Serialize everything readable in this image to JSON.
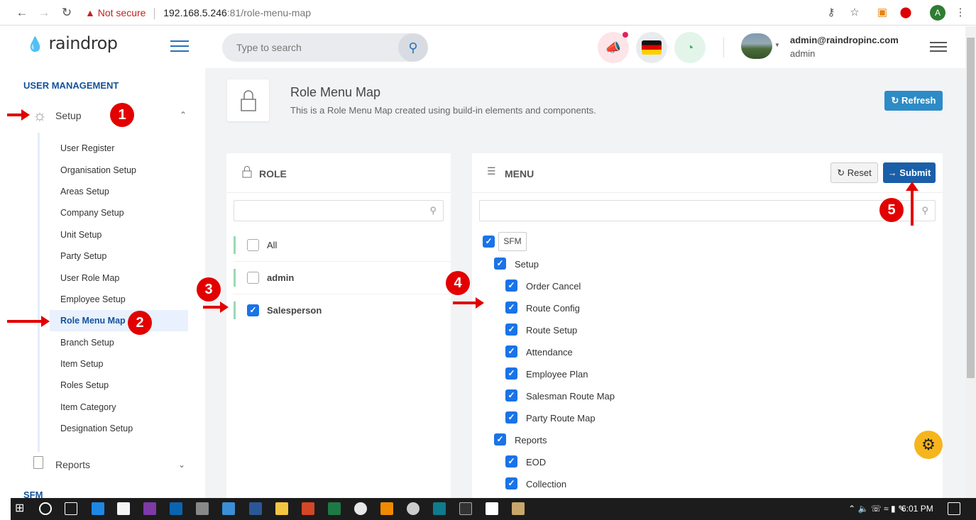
{
  "browser": {
    "not_secure": "Not secure",
    "url_host": "192.168.5.246",
    "url_path": ":81/role-menu-map"
  },
  "sidebar": {
    "logo": "raindrop",
    "section_user_mgmt": "USER MANAGEMENT",
    "setup_label": "Setup",
    "items": [
      "User Register",
      "Organisation Setup",
      "Areas Setup",
      "Company Setup",
      "Unit Setup",
      "Party Setup",
      "User Role Map",
      "Employee Setup",
      "Role Menu Map",
      "Branch Setup",
      "Item Setup",
      "Roles Setup",
      "Item Category",
      "Designation Setup"
    ],
    "active_item": "Role Menu Map",
    "reports_label": "Reports",
    "section_sfm": "SFM"
  },
  "header": {
    "search_placeholder": "Type to search",
    "user_email": "admin@raindropinc.com",
    "user_role": "admin"
  },
  "page": {
    "title": "Role Menu Map",
    "subtitle": "This is a Role Menu Map created using build-in elements and components.",
    "refresh_label": "Refresh"
  },
  "role_panel": {
    "title": "ROLE",
    "roles": [
      {
        "label": "All",
        "checked": false
      },
      {
        "label": "admin",
        "checked": false
      },
      {
        "label": "Salesperson",
        "checked": true
      }
    ]
  },
  "menu_panel": {
    "title": "MENU",
    "reset_label": "Reset",
    "submit_label": "Submit",
    "root": "SFM",
    "groups": [
      {
        "label": "Setup",
        "items": [
          "Order Cancel",
          "Route Config",
          "Route Setup",
          "Attendance",
          "Employee Plan",
          "Salesman Route Map",
          "Party Route Map"
        ]
      },
      {
        "label": "Reports",
        "items": [
          "EOD",
          "Collection"
        ]
      }
    ]
  },
  "annotations": [
    "1",
    "2",
    "3",
    "4",
    "5"
  ],
  "taskbar": {
    "time": "6:01 PM"
  },
  "colors": {
    "primary": "#1a5fa8",
    "accent": "#2d8bc6",
    "checkbox": "#1a73e8",
    "annotation": "#e20000",
    "fab": "#f6b51c"
  }
}
